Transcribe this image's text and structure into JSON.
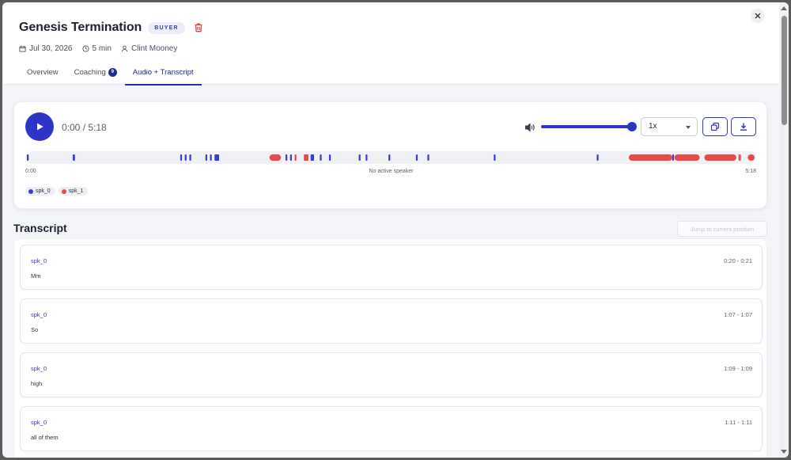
{
  "header": {
    "title": "Genesis Termination",
    "badge": "BUYER",
    "date": "Jul 30, 2026",
    "duration": "5 min",
    "owner": "Clint Mooney"
  },
  "tabs": [
    {
      "label": "Overview",
      "active": false
    },
    {
      "label": "Coaching",
      "count": "9",
      "active": false
    },
    {
      "label": "Audio + Transcript",
      "active": true
    }
  ],
  "player": {
    "time_display": "0:00 / 5:18",
    "speed": "1x",
    "volume_fraction": 1.0,
    "timeline_start": "0:00",
    "timeline_end": "5:18",
    "timeline_status": "No active speaker",
    "total_seconds": 318,
    "speakers": [
      {
        "name": "spk_0",
        "color": "#3b3fd0"
      },
      {
        "name": "spk_1",
        "color": "#e84a4a"
      }
    ],
    "segments": [
      {
        "speaker": 0,
        "start": 0,
        "end": 0.8
      },
      {
        "speaker": 0,
        "start": 20,
        "end": 21
      },
      {
        "speaker": 0,
        "start": 67,
        "end": 67.8
      },
      {
        "speaker": 0,
        "start": 69,
        "end": 69.8
      },
      {
        "speaker": 0,
        "start": 71,
        "end": 71.8
      },
      {
        "speaker": 0,
        "start": 78,
        "end": 78.8
      },
      {
        "speaker": 0,
        "start": 80,
        "end": 80.8
      },
      {
        "speaker": 0,
        "start": 82,
        "end": 84
      },
      {
        "speaker": 1,
        "start": 106,
        "end": 111
      },
      {
        "speaker": 0,
        "start": 113,
        "end": 113.8
      },
      {
        "speaker": 0,
        "start": 115,
        "end": 115.8
      },
      {
        "speaker": 1,
        "start": 117,
        "end": 117.8
      },
      {
        "speaker": 1,
        "start": 121,
        "end": 123
      },
      {
        "speaker": 0,
        "start": 124,
        "end": 125.5
      },
      {
        "speaker": 0,
        "start": 128,
        "end": 128.8
      },
      {
        "speaker": 0,
        "start": 132,
        "end": 132.8
      },
      {
        "speaker": 0,
        "start": 145,
        "end": 145.8
      },
      {
        "speaker": 0,
        "start": 148,
        "end": 148.8
      },
      {
        "speaker": 0,
        "start": 158,
        "end": 158.8
      },
      {
        "speaker": 0,
        "start": 170,
        "end": 170.8
      },
      {
        "speaker": 0,
        "start": 175,
        "end": 175.8
      },
      {
        "speaker": 0,
        "start": 204,
        "end": 204.8
      },
      {
        "speaker": 0,
        "start": 249,
        "end": 249.8
      },
      {
        "speaker": 1,
        "start": 263,
        "end": 282
      },
      {
        "speaker": 0,
        "start": 282,
        "end": 282.8
      },
      {
        "speaker": 1,
        "start": 283,
        "end": 294
      },
      {
        "speaker": 1,
        "start": 296,
        "end": 310
      },
      {
        "speaker": 1,
        "start": 311,
        "end": 312
      },
      {
        "speaker": 1,
        "start": 315,
        "end": 318
      }
    ]
  },
  "transcript": {
    "title": "Transcript",
    "jump_label": "Jump to current position",
    "entries": [
      {
        "speaker": "spk_0",
        "time": "0:20 - 0:21",
        "text": "Mm"
      },
      {
        "speaker": "spk_0",
        "time": "1:07 - 1:07",
        "text": "So"
      },
      {
        "speaker": "spk_0",
        "time": "1:09 - 1:09",
        "text": "high"
      },
      {
        "speaker": "spk_0",
        "time": "1:11 - 1:11",
        "text": "all of them"
      }
    ]
  }
}
